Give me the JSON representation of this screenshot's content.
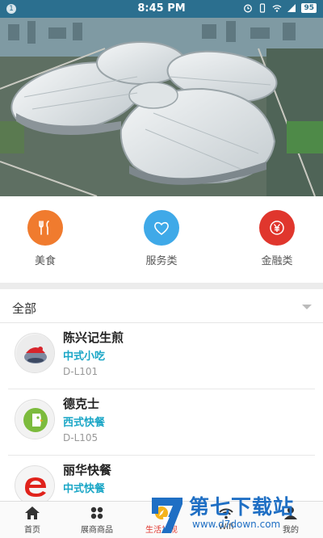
{
  "status_bar": {
    "notification_count": "1",
    "time": "8:45 PM",
    "battery": "95",
    "icons": [
      "alarm-icon",
      "vibrate-icon",
      "wifi-icon",
      "signal-icon",
      "battery-icon"
    ]
  },
  "hero": {
    "image": "convention-center-aerial-photo"
  },
  "categories": [
    {
      "label": "美食",
      "icon": "fork-knife-icon",
      "color": "#f07b2e"
    },
    {
      "label": "服务类",
      "icon": "heart-icon",
      "color": "#3fa9e8"
    },
    {
      "label": "金融类",
      "icon": "yuan-icon",
      "color": "#e0362d"
    }
  ],
  "filter": {
    "label": "全部"
  },
  "list": [
    {
      "name": "陈兴记生煎",
      "type": "中式小吃",
      "location": "D-L101"
    },
    {
      "name": "德克士",
      "type": "西式快餐",
      "location": "D-L105"
    },
    {
      "name": "丽华快餐",
      "type": "中式快餐",
      "location": ""
    }
  ],
  "bottom_nav": [
    {
      "label": "首页",
      "icon": "home-icon"
    },
    {
      "label": "展商商品",
      "icon": "grid-icon"
    },
    {
      "label": "生活发现",
      "icon": "compass-icon",
      "active": true
    },
    {
      "label": "Wifi",
      "icon": "wifi-icon"
    },
    {
      "label": "我的",
      "icon": "user-icon"
    }
  ],
  "watermark": {
    "title": "第七下载站",
    "url": "www.d7down.com"
  },
  "colors": {
    "accent_blue": "#1aa6c6",
    "status_bar": "#2b6f8f",
    "active_nav": "#e0362d"
  }
}
